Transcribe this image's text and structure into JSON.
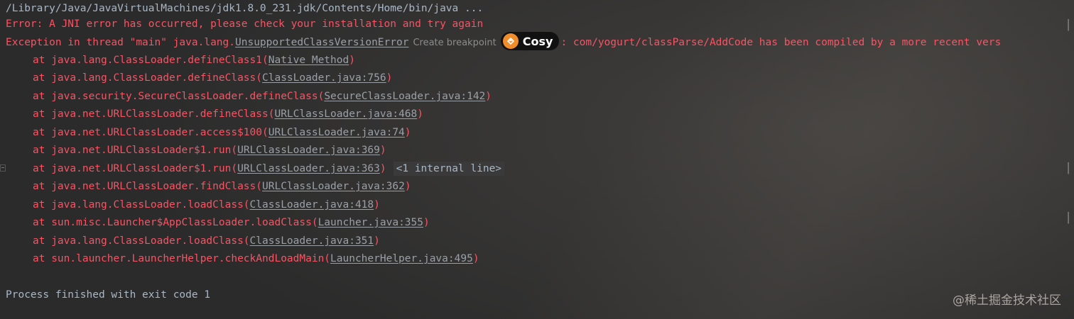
{
  "console": {
    "command": "/Library/Java/JavaVirtualMachines/jdk1.8.0_231.jdk/Contents/Home/bin/java ...",
    "error_line": "Error: A JNI error has occurred, please check your installation and try again",
    "exception": {
      "prefix": "Exception in thread \"main\" java.lang.",
      "class_link": "UnsupportedClassVersionError",
      "breakpoint_hint": "Create breakpoint",
      "badge_label": "Cosy",
      "message": ": com/yogurt/classParse/AddCode has been compiled by a more recent vers"
    },
    "stack": [
      {
        "at": "at java.lang.ClassLoader.defineClass1(",
        "link": "Native Method",
        "close": ")"
      },
      {
        "at": "at java.lang.ClassLoader.defineClass(",
        "link": "ClassLoader.java:756",
        "close": ")"
      },
      {
        "at": "at java.security.SecureClassLoader.defineClass(",
        "link": "SecureClassLoader.java:142",
        "close": ")"
      },
      {
        "at": "at java.net.URLClassLoader.defineClass(",
        "link": "URLClassLoader.java:468",
        "close": ")"
      },
      {
        "at": "at java.net.URLClassLoader.access$100(",
        "link": "URLClassLoader.java:74",
        "close": ")"
      },
      {
        "at": "at java.net.URLClassLoader$1.run(",
        "link": "URLClassLoader.java:369",
        "close": ")"
      },
      {
        "at": "at java.net.URLClassLoader$1.run(",
        "link": "URLClassLoader.java:363",
        "close": ")",
        "internal": "<1 internal line>"
      },
      {
        "at": "at java.net.URLClassLoader.findClass(",
        "link": "URLClassLoader.java:362",
        "close": ")"
      },
      {
        "at": "at java.lang.ClassLoader.loadClass(",
        "link": "ClassLoader.java:418",
        "close": ")"
      },
      {
        "at": "at sun.misc.Launcher$AppClassLoader.loadClass(",
        "link": "Launcher.java:355",
        "close": ")"
      },
      {
        "at": "at java.lang.ClassLoader.loadClass(",
        "link": "ClassLoader.java:351",
        "close": ")"
      },
      {
        "at": "at sun.launcher.LauncherHelper.checkAndLoadMain(",
        "link": "LauncherHelper.java:495",
        "close": ")"
      }
    ],
    "finish": "Process finished with exit code 1"
  },
  "watermark": "@稀土掘金技术社区",
  "colors": {
    "background": "#2b2b2b",
    "error_red": "#f75464",
    "plain_text": "#a9b7c6",
    "link_gray": "#9aa0a6",
    "badge_orange": "#f08c2c"
  }
}
